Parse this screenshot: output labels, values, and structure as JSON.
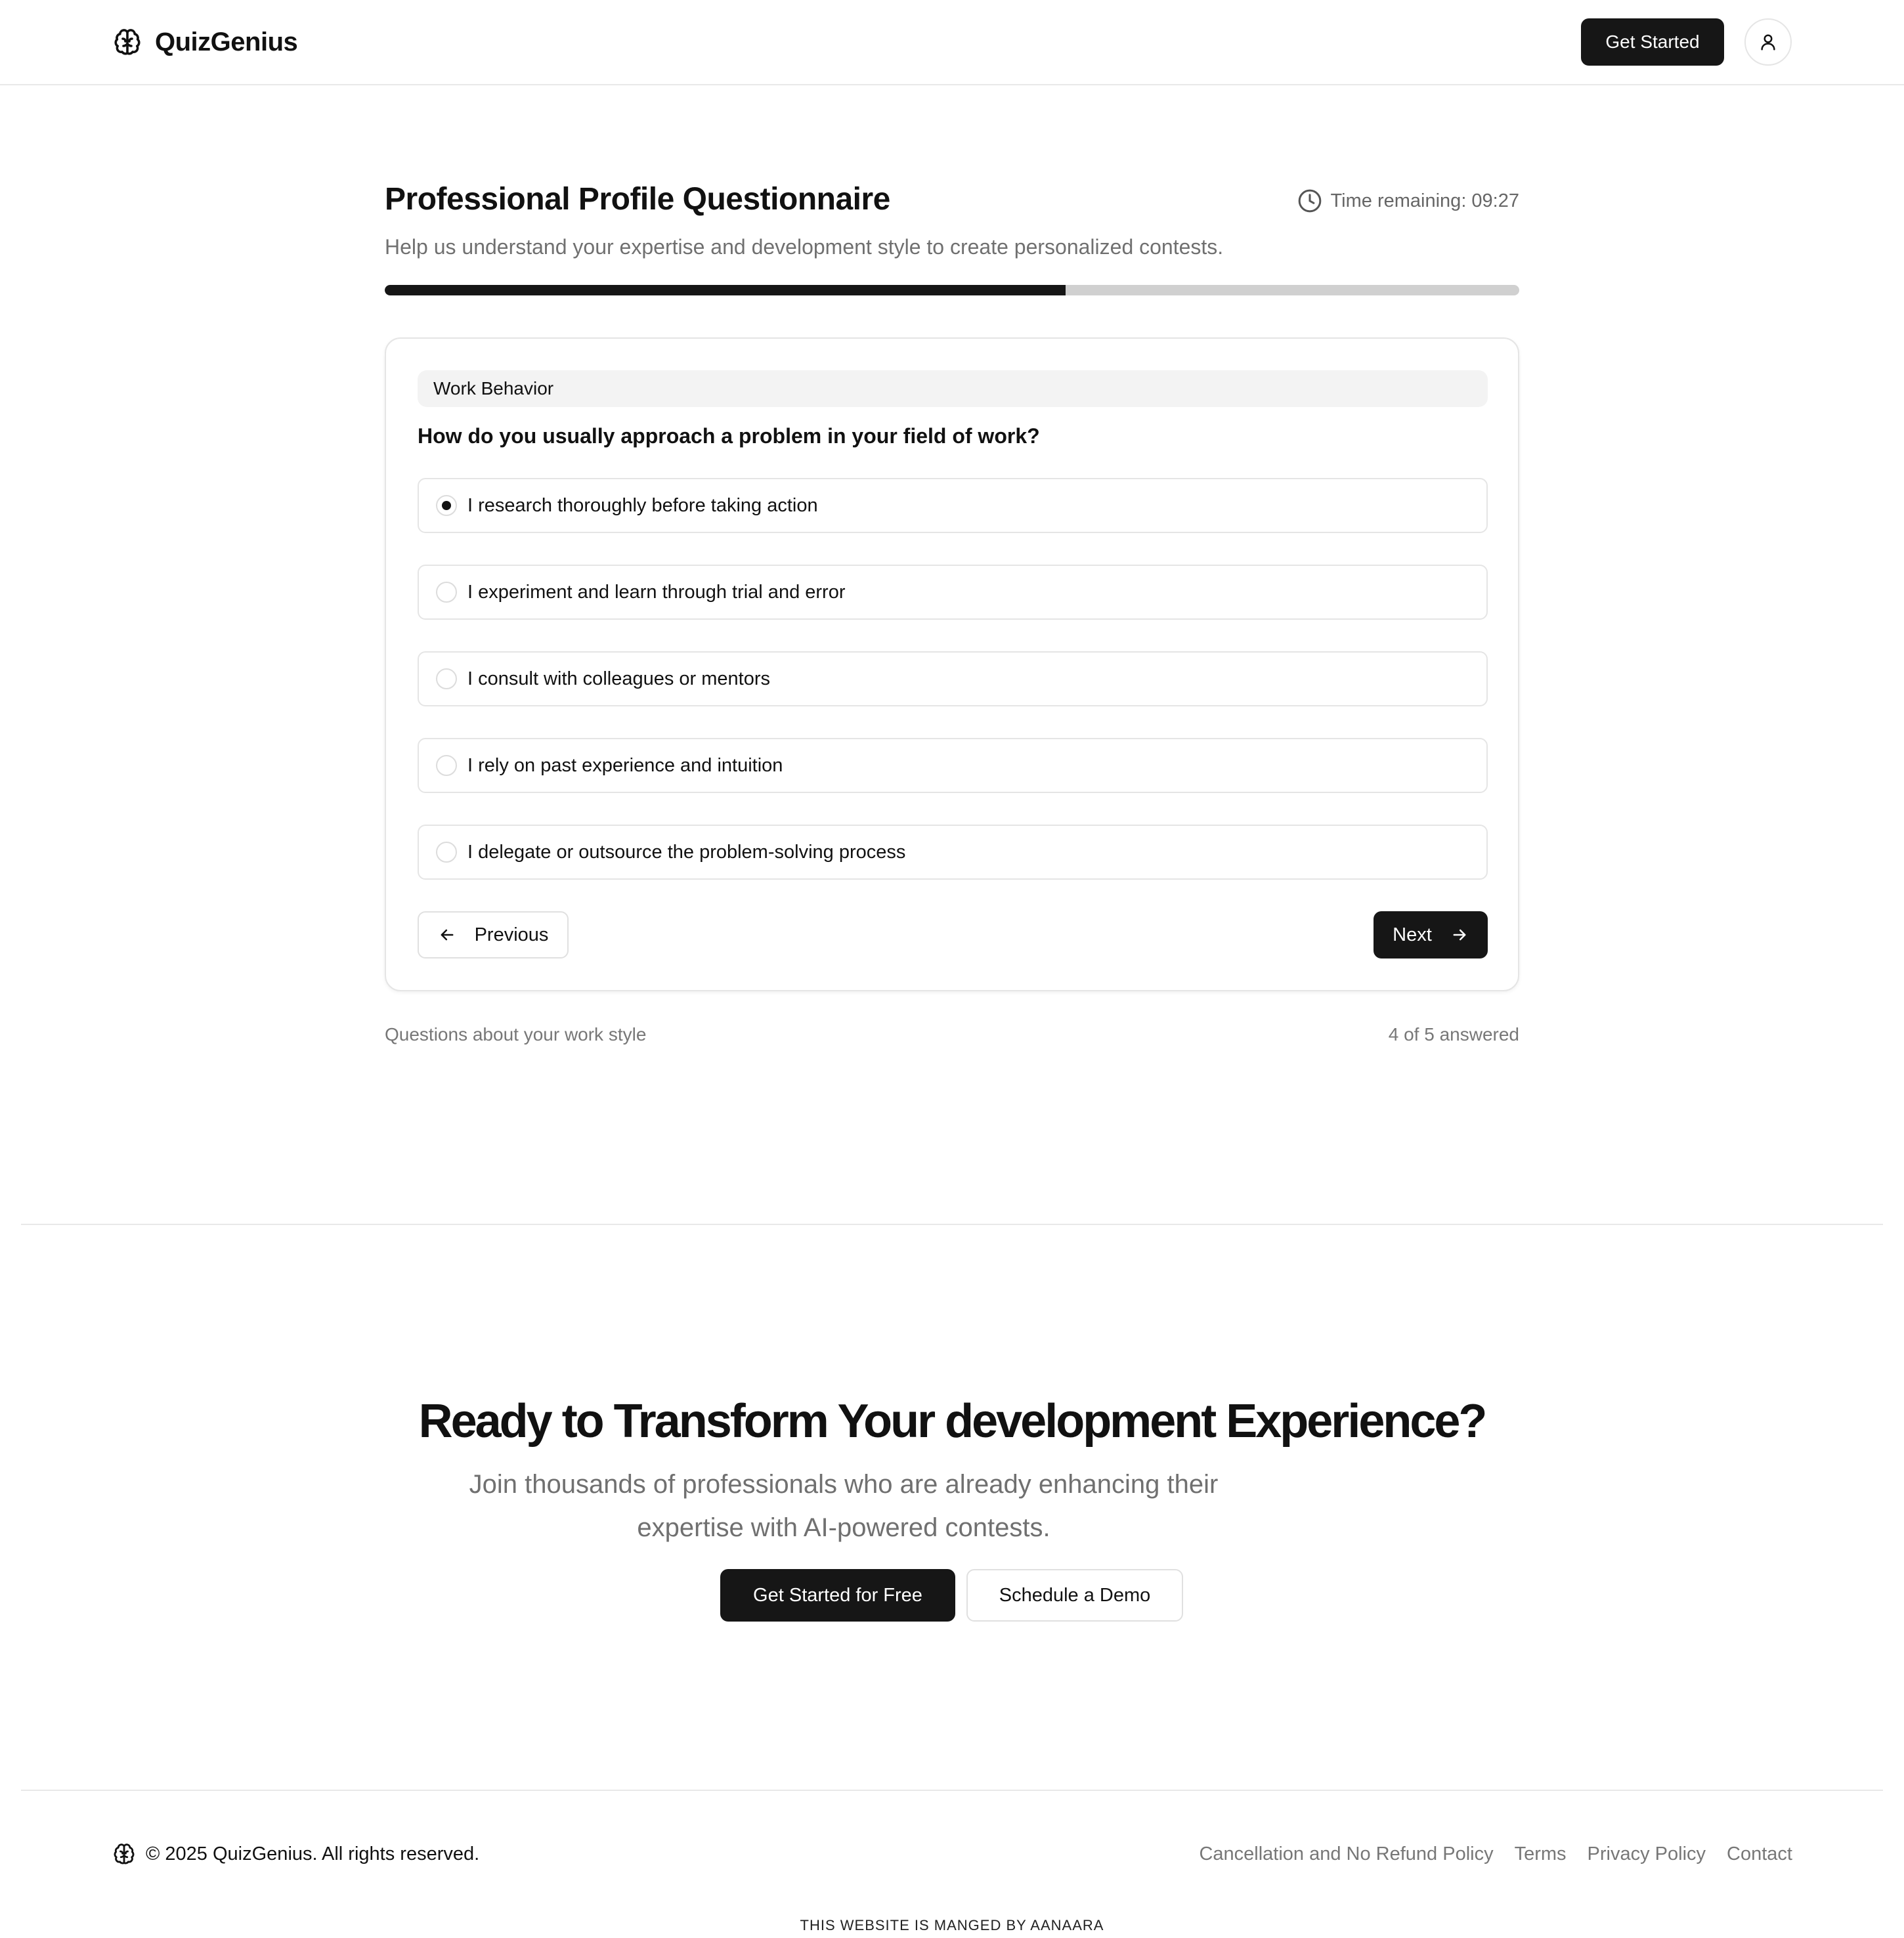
{
  "header": {
    "brand": "QuizGenius",
    "get_started_label": "Get Started"
  },
  "quiz": {
    "title": "Professional Profile Questionnaire",
    "subtitle": "Help us understand your expertise and development style to create personalized contests.",
    "timer_label": "Time remaining: 09:27",
    "progress_fraction": 0.6,
    "category": "Work Behavior",
    "question": "How do you usually approach a problem in your field of work?",
    "options": [
      {
        "label": "I research thoroughly before taking action",
        "selected": true
      },
      {
        "label": "I experiment and learn through trial and error",
        "selected": false
      },
      {
        "label": "I consult with colleagues or mentors",
        "selected": false
      },
      {
        "label": "I rely on past experience and intuition",
        "selected": false
      },
      {
        "label": "I delegate or outsource the problem-solving process",
        "selected": false
      }
    ],
    "previous_label": "Previous",
    "next_label": "Next",
    "section_note": "Questions about your work style",
    "answered_note": "4 of 5 answered"
  },
  "cta": {
    "title": "Ready to Transform Your development Experience?",
    "subtitle": "Join thousands of professionals who are already enhancing their expertise with AI-powered contests.",
    "primary_label": "Get Started for Free",
    "secondary_label": "Schedule a Demo"
  },
  "footer": {
    "copyright": "© 2025 QuizGenius. All rights reserved.",
    "links": [
      "Cancellation and No Refund Policy",
      "Terms",
      "Privacy Policy",
      "Contact"
    ],
    "managed_by": "THIS WEBSITE IS MANGED BY AANAARA"
  },
  "icons": {
    "brand": "brain-icon",
    "avatar": "user-icon",
    "timer": "clock-icon",
    "previous": "arrow-left-icon",
    "next": "arrow-right-icon"
  },
  "colors": {
    "primary": "#161616",
    "muted_text": "#707070",
    "border": "#e5e5e5",
    "progress_track": "#d0d0d0"
  }
}
